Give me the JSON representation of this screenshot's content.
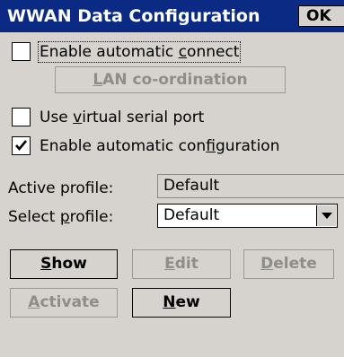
{
  "window": {
    "title": "WWAN Data Configuration",
    "ok_label": "OK"
  },
  "options": {
    "auto_connect": {
      "pre": "Enable automatic ",
      "key": "c",
      "post": "onnect",
      "checked": false
    },
    "lan_button": {
      "key": "L",
      "post": "AN co-ordination",
      "enabled": false
    },
    "virtual_serial": {
      "pre": "Use ",
      "key": "v",
      "post": "irtual serial port",
      "checked": false
    },
    "auto_config": {
      "pre": "Enable automatic con",
      "key": "f",
      "post": "iguration",
      "checked": true
    }
  },
  "profile": {
    "active_label": "Active profile:",
    "active_value": "Default",
    "select_pre": "Select ",
    "select_key": "p",
    "select_post": "rofile:",
    "select_value": "Default"
  },
  "buttons": {
    "show": {
      "key": "S",
      "post": "how",
      "enabled": true
    },
    "edit": {
      "key": "E",
      "post": "dit",
      "enabled": false
    },
    "delete": {
      "key": "D",
      "post": "elete",
      "enabled": false
    },
    "activate": {
      "key": "A",
      "post": "ctivate",
      "enabled": false
    },
    "new": {
      "key": "N",
      "post": "ew",
      "enabled": true
    }
  },
  "colors": {
    "titlebar": "#0b2a84",
    "background": "#d6d3ce",
    "disabled_text": "#8f8d89"
  }
}
